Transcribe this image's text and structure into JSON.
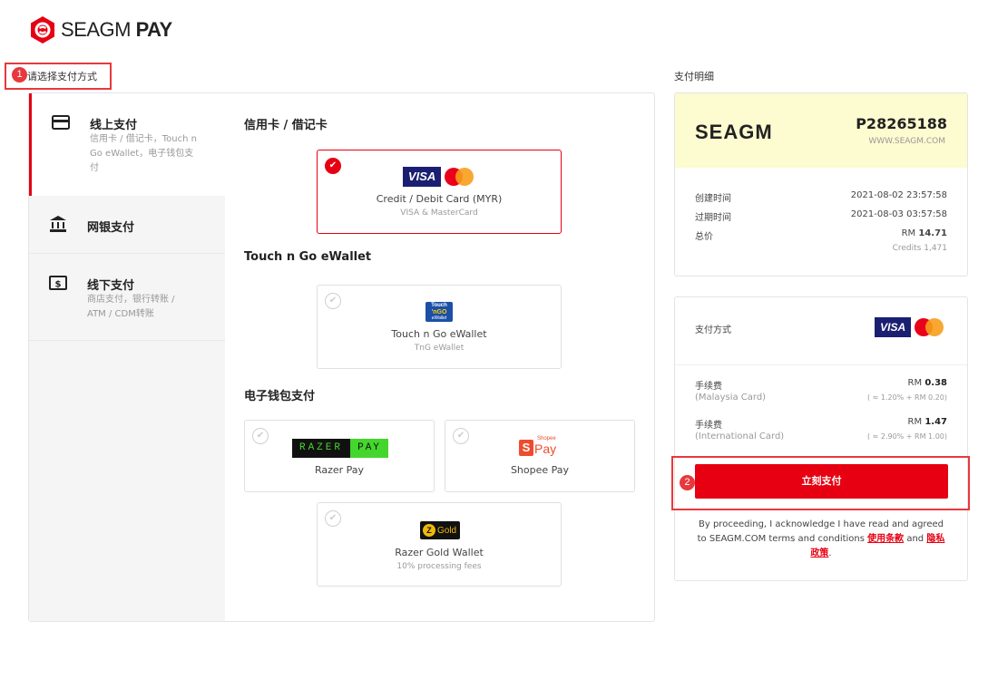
{
  "header": {
    "logo_text_light": "SEAGM",
    "logo_text_bold": "PAY"
  },
  "step1": {
    "badge": "1",
    "title": "请选择支付方式"
  },
  "step2": {
    "badge": "2"
  },
  "sidebar": {
    "items": [
      {
        "icon": "credit-card-icon",
        "label": "线上支付",
        "desc": "信用卡 / 借记卡，Touch n Go eWallet，电子钱包支付"
      },
      {
        "icon": "bank-icon",
        "label": "网银支付",
        "desc": ""
      },
      {
        "icon": "cash-icon",
        "label": "线下支付",
        "desc": "商店支付，银行转账 / ATM / CDM转账"
      }
    ]
  },
  "sections": {
    "credit": {
      "title": "信用卡 / 借记卡",
      "name": "Credit / Debit Card (MYR)",
      "sub": "VISA & MasterCard",
      "visa": "VISA"
    },
    "tng": {
      "title": "Touch n Go eWallet",
      "name": "Touch n Go eWallet",
      "sub": "TnG eWallet",
      "logo_top": "Touch",
      "logo_mid": "'nGO",
      "logo_bottom": "eWallet"
    },
    "ewallet": {
      "title": "电子钱包支付",
      "razer": {
        "name": "Razer Pay",
        "logo_left": "RAZER",
        "logo_right": "PAY"
      },
      "shopee": {
        "name": "Shopee Pay",
        "logo_s": "S",
        "logo_small": "Shopee",
        "logo_pay": "Pay"
      },
      "gold": {
        "name": "Razer Gold Wallet",
        "sub": "10% processing fees",
        "logo_z": "Z",
        "logo_text": "Gold"
      }
    }
  },
  "right": {
    "title": "支付明细",
    "receipt": {
      "logo": "SEAGM",
      "order_no": "P28265188",
      "site": "WWW.SEAGM.COM",
      "created_label": "创建时间",
      "created_value": "2021-08-02 23:57:58",
      "expire_label": "过期时间",
      "expire_value": "2021-08-03 03:57:58",
      "total_label": "总价",
      "total_currency": "RM",
      "total_amount": "14.71",
      "credits_label": "Credits",
      "credits_value": "1,471"
    },
    "payment": {
      "method_label": "支付方式",
      "visa": "VISA",
      "fee1_label": "手续费",
      "fee1_sub": "(Malaysia Card)",
      "fee1_currency": "RM",
      "fee1_amount": "0.38",
      "fee1_note": "( ≈ 1.20% + RM 0.20)",
      "fee2_label": "手续费",
      "fee2_sub": "(International Card)",
      "fee2_currency": "RM",
      "fee2_amount": "1.47",
      "fee2_note": "( ≈ 2.90% + RM 1.00)",
      "pay_button": "立刻支付"
    },
    "terms": {
      "text1": "By proceeding, I acknowledge I have read and agreed to SEAGM.COM terms and conditions",
      "link1": "使用条款",
      "and": "and",
      "link2": "隐私政策",
      "end": "."
    }
  },
  "colors": {
    "accent": "#e60012",
    "annotation": "#e8383d",
    "receipt_bg": "#fdfbd0",
    "visa_blue": "#1a1f71"
  }
}
